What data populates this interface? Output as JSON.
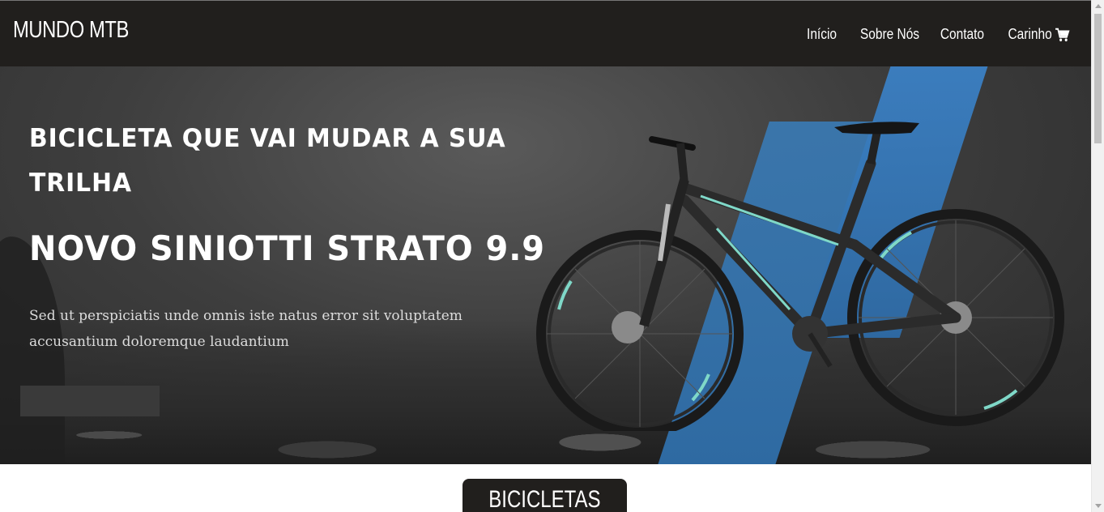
{
  "header": {
    "logo": "MUNDO MTB",
    "nav": [
      {
        "label": "Início"
      },
      {
        "label": "Sobre Nós"
      },
      {
        "label": "Contato"
      },
      {
        "label": "Carinho",
        "icon": "cart-icon"
      }
    ]
  },
  "hero": {
    "subtitle": "BICICLETA QUE VAI MUDAR A SUA TRILHA",
    "title": "NOVO SINIOTTI STRATO 9.9",
    "description": "Sed ut perspiciatis unde omnis iste natus error sit voluptatem accusantium doloremque laudantium",
    "button_label": ""
  },
  "section": {
    "label": "BICICLETAS"
  },
  "colors": {
    "header_bg": "#211f1d",
    "accent_blue": "#3a78b0",
    "bike_accent": "#7fd8c8"
  }
}
